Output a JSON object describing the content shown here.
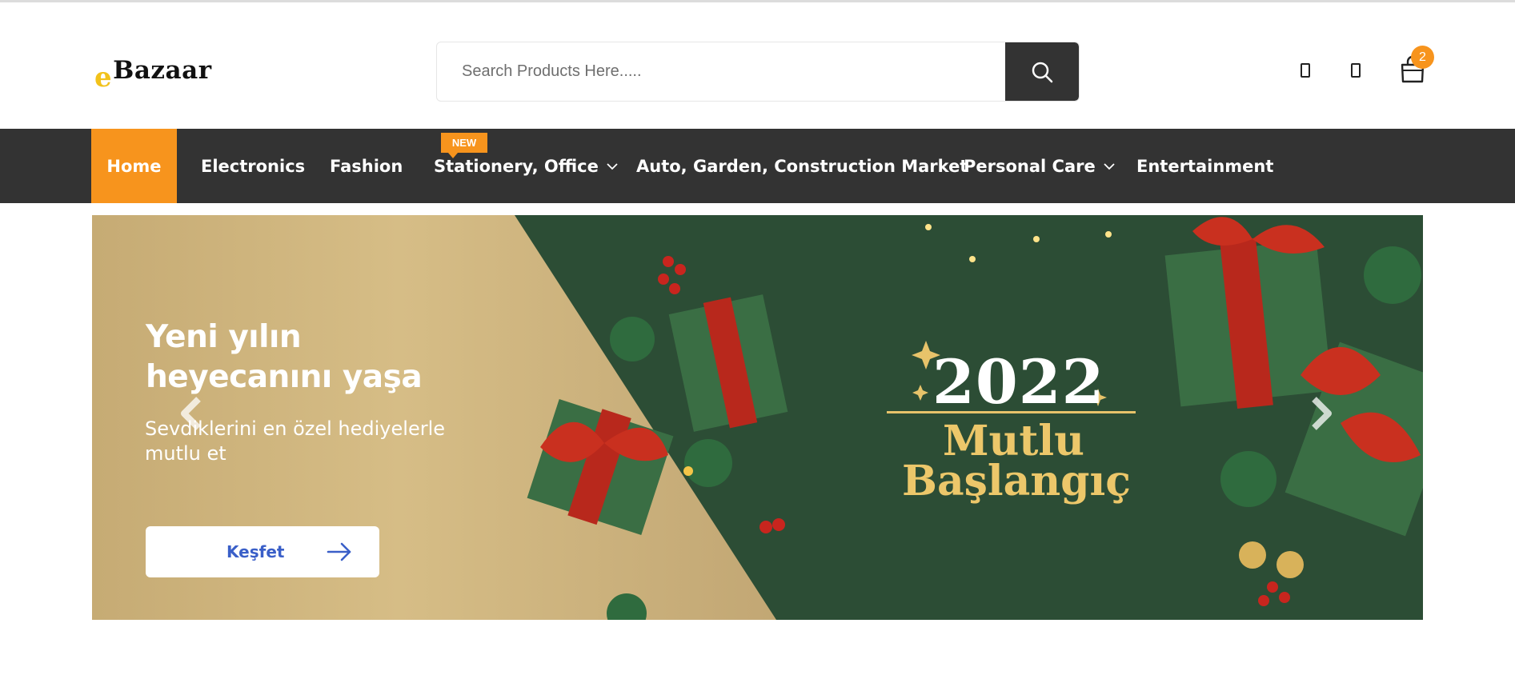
{
  "header": {
    "logo_prefix": "e",
    "logo_text": "Bazaar",
    "search_placeholder": "Search Products Here.....",
    "cart_count": "2"
  },
  "nav": {
    "items": [
      {
        "label": "Home"
      },
      {
        "label": "Electronics"
      },
      {
        "label": "Fashion"
      },
      {
        "label": "Stationery, Office"
      },
      {
        "label": "Auto, Garden, Construction Market"
      },
      {
        "label": "Personal Care"
      },
      {
        "label": "Entertainment"
      }
    ],
    "new_badge": "NEW"
  },
  "banner": {
    "headline_line1": "Yeni yılın",
    "headline_line2": "heyecanını yaşa",
    "subtitle_line1": "Sevdiklerini en özel hediyelerle",
    "subtitle_line2": "mutlu et",
    "cta_label": "Keşfet",
    "title_year": "2022",
    "title_word1": "Mutlu",
    "title_word2": "Başlangıç"
  },
  "colors": {
    "accent": "#f7941d",
    "nav_bg": "#333333",
    "banner_green": "#2c4d35",
    "banner_gold": "#cdb37c",
    "cta_text": "#3a5fc8",
    "title_gold": "#ecc76a"
  },
  "icons": [
    "search-icon",
    "user-icon",
    "heart-icon",
    "cart-icon",
    "chevron-down-icon",
    "arrow-right-icon",
    "chevron-left-icon",
    "chevron-right-icon"
  ]
}
